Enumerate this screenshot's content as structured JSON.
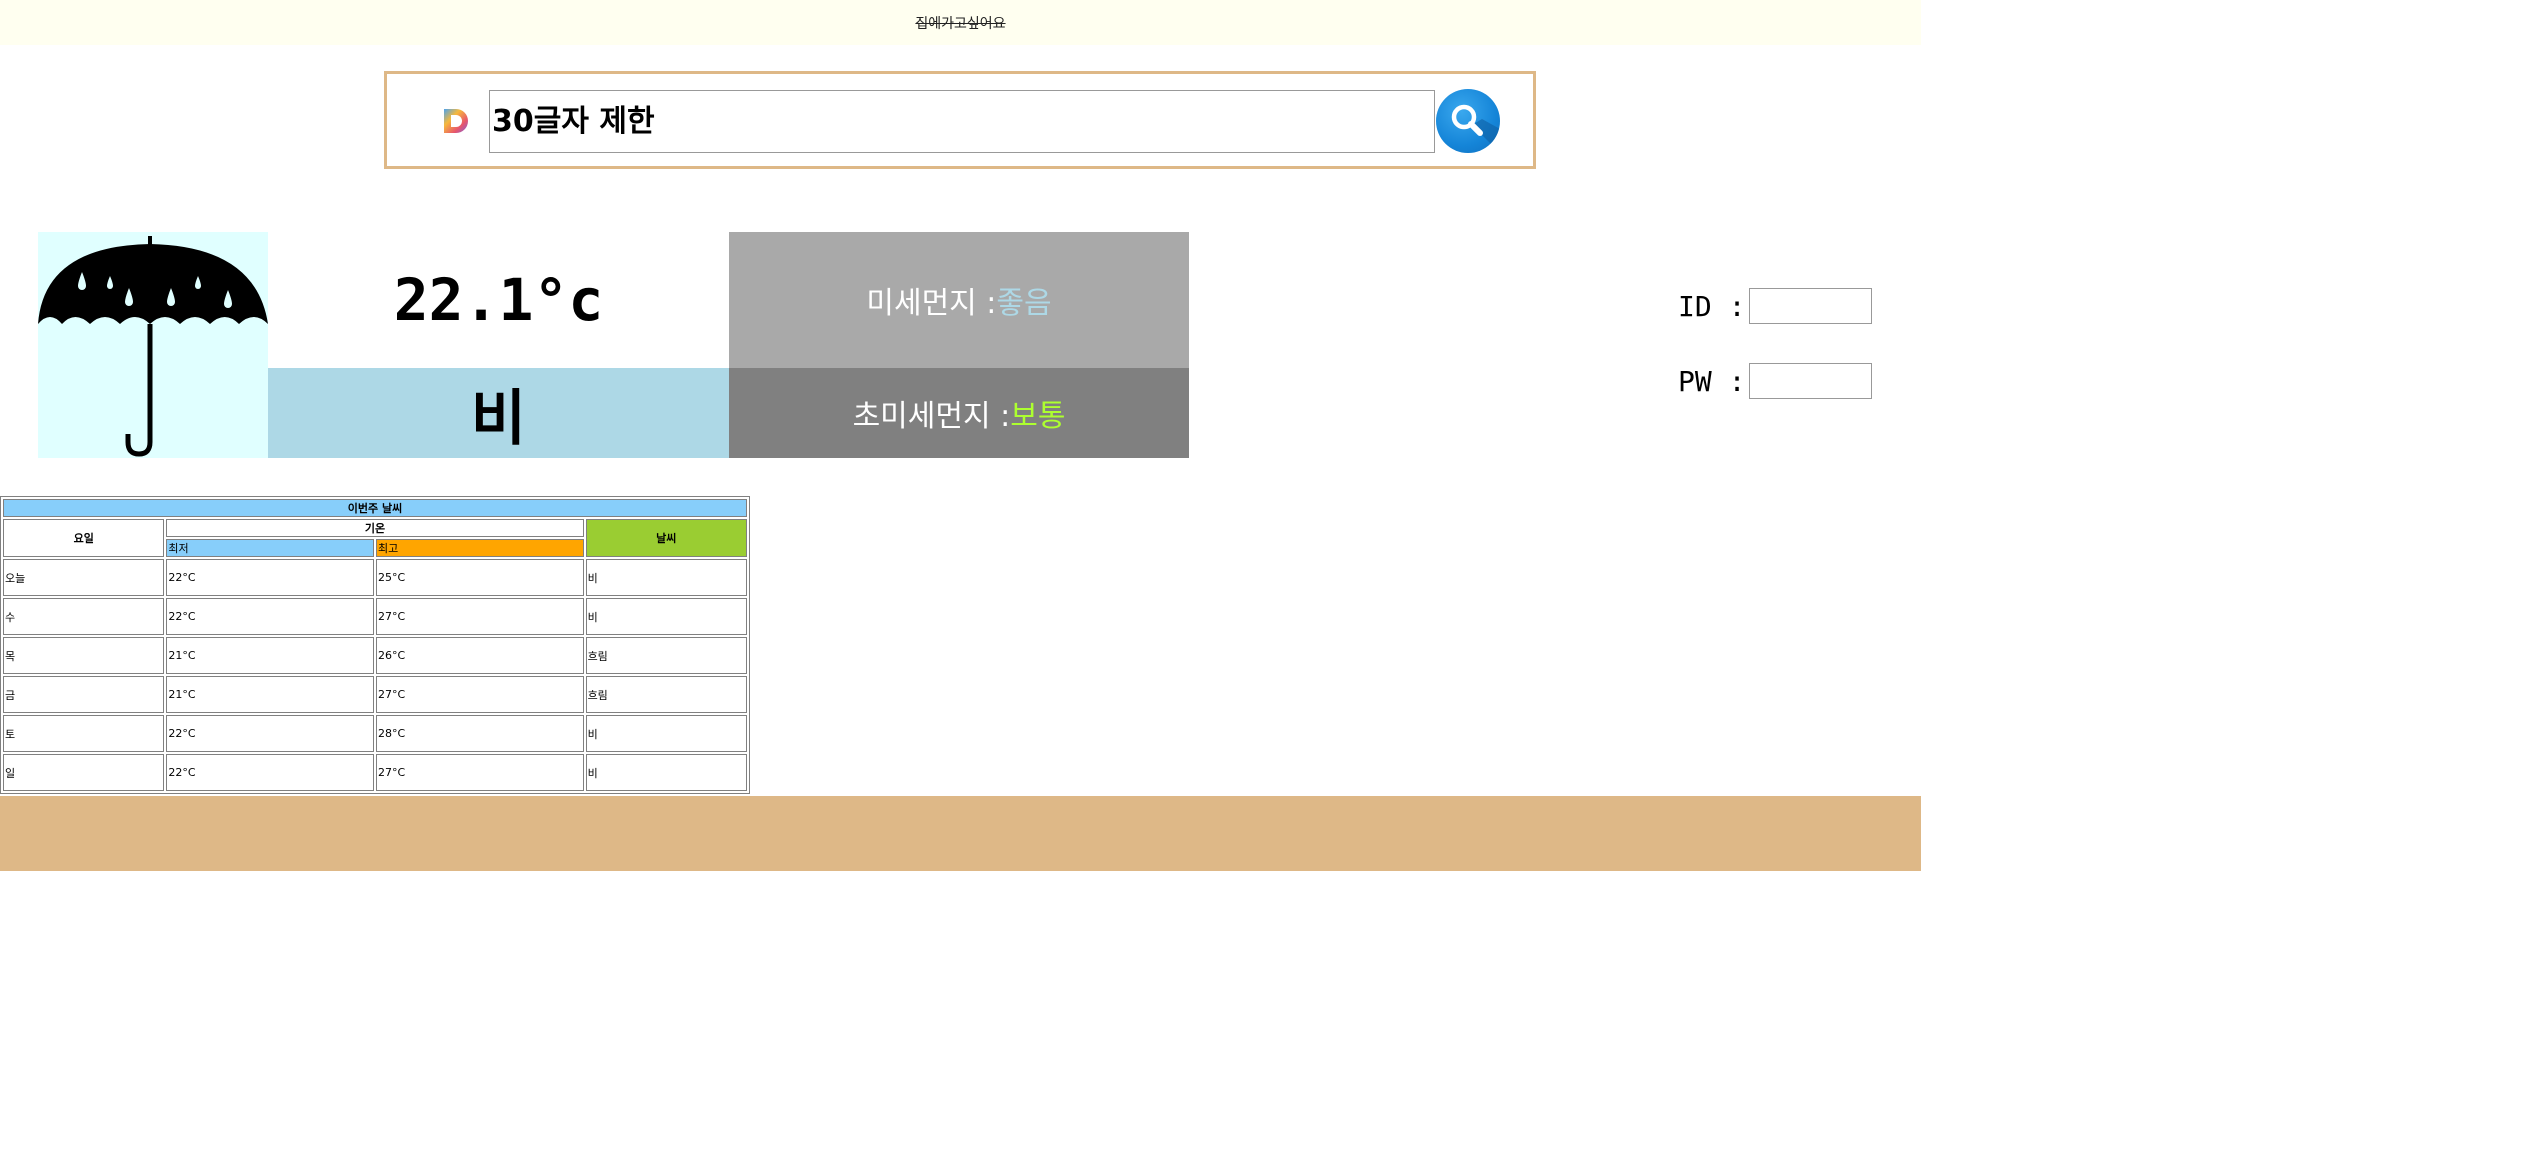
{
  "banner": {
    "text": "집에가고싶어요"
  },
  "search": {
    "logo_icon": "daum-d-logo",
    "placeholder": "30글자 제한",
    "button_icon": "magnifier-icon"
  },
  "current_weather": {
    "icon": "umbrella-rain-icon",
    "temperature": "22.1°c",
    "condition": "비",
    "fine_dust_label": "미세먼지 :",
    "fine_dust_value": "좋음",
    "ultrafine_dust_label": "초미세먼지 :",
    "ultrafine_dust_value": "보통",
    "colors": {
      "icon_bg": "#e0ffff",
      "condition_bg": "#add8e6",
      "fine_dust_bg": "#a9a9a9",
      "ultrafine_dust_bg": "#808080",
      "fine_dust_value_color": "#add8e6",
      "ultrafine_dust_value_color": "#adff2f"
    }
  },
  "login": {
    "id_label": "ID :",
    "pw_label": "PW :"
  },
  "weekly_table": {
    "caption": "이번주 날씨",
    "headers": {
      "day": "요일",
      "temperature": "기온",
      "low": "최저",
      "high": "최고",
      "weather": "날씨"
    },
    "rows": [
      {
        "day": "오늘",
        "low": "22°C",
        "high": "25°C",
        "weather": "비"
      },
      {
        "day": "수",
        "low": "22°C",
        "high": "27°C",
        "weather": "비"
      },
      {
        "day": "목",
        "low": "21°C",
        "high": "26°C",
        "weather": "흐림"
      },
      {
        "day": "금",
        "low": "21°C",
        "high": "27°C",
        "weather": "흐림"
      },
      {
        "day": "토",
        "low": "22°C",
        "high": "28°C",
        "weather": "비"
      },
      {
        "day": "일",
        "low": "22°C",
        "high": "27°C",
        "weather": "비"
      }
    ]
  },
  "colors": {
    "banner_bg": "#fffff0",
    "search_border": "#deb887",
    "footer_bg": "#deb887",
    "table_caption_bg": "#87cefa",
    "table_low_bg": "#87cefa",
    "table_high_bg": "#ffa500",
    "table_weather_bg": "#9acd32"
  }
}
